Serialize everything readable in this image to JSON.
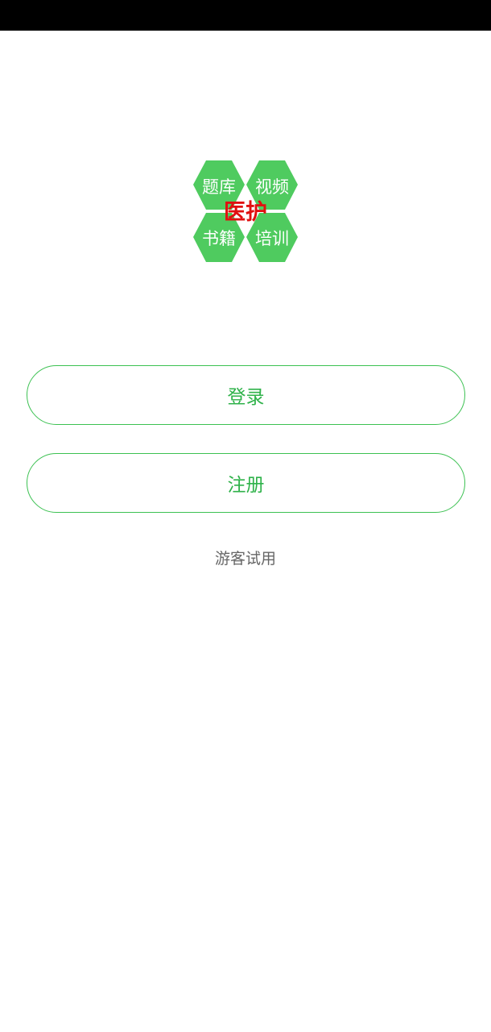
{
  "logo": {
    "cells": [
      "题库",
      "视频",
      "书籍",
      "培训"
    ],
    "center_text": "医护",
    "hex_color": "#4fcb5f",
    "center_color": "#e01010"
  },
  "actions": {
    "login_label": "登录",
    "register_label": "注册",
    "guest_label": "游客试用"
  },
  "colors": {
    "accent": "#3cc152",
    "status_bar": "#000000",
    "muted_text": "#666666"
  }
}
